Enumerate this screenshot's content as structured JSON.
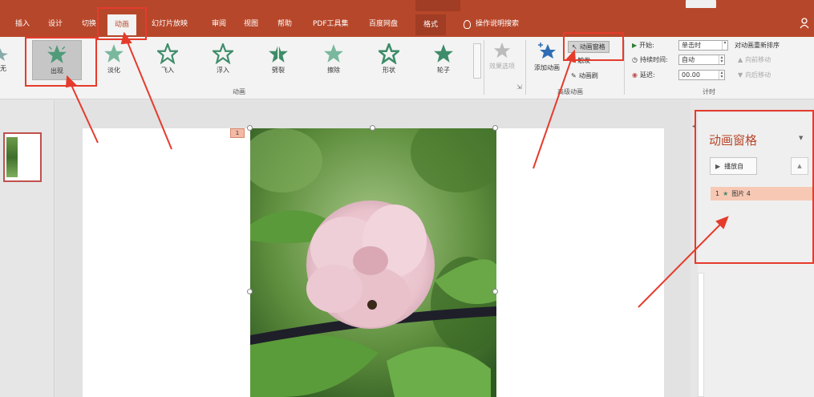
{
  "title_bar": {
    "context_label": "",
    "window_button": ""
  },
  "tabs": [
    {
      "label": "插入"
    },
    {
      "label": "设计"
    },
    {
      "label": "切换"
    },
    {
      "label": "动画"
    },
    {
      "label": "幻灯片放映"
    },
    {
      "label": "审阅"
    },
    {
      "label": "视图"
    },
    {
      "label": "帮助"
    },
    {
      "label": "PDF工具集"
    },
    {
      "label": "百度网盘"
    },
    {
      "label": "格式"
    }
  ],
  "active_tab_index": 3,
  "tell_me": {
    "label": "操作说明搜索"
  },
  "ribbon": {
    "gallery_partial_label": "无",
    "animations": [
      {
        "label": "出现",
        "selected": true
      },
      {
        "label": "淡化"
      },
      {
        "label": "飞入"
      },
      {
        "label": "浮入"
      },
      {
        "label": "劈裂"
      },
      {
        "label": "擦除"
      },
      {
        "label": "形状"
      },
      {
        "label": "轮子"
      }
    ],
    "effect_options": "效果选项",
    "add_animation": "添加动画",
    "animation_pane_button": "动画窗格",
    "trigger": "触发",
    "animation_painter": "动画刷",
    "group_animation": "动画",
    "group_advanced": "高级动画",
    "group_timing": "计时",
    "timing": {
      "start_label": "开始:",
      "start_value": "单击时",
      "duration_label": "持续时间:",
      "duration_value": "自动",
      "delay_label": "延迟:",
      "delay_value": "00.00"
    },
    "reorder": {
      "title": "对动画重新排序",
      "move_earlier": "向前移动",
      "move_later": "向后移动"
    }
  },
  "slide": {
    "anim_badge": "1"
  },
  "animation_pane": {
    "title": "动画窗格",
    "play_button": "播放自",
    "items": [
      {
        "order": "1",
        "name": "图片 4"
      }
    ]
  },
  "colors": {
    "accent": "#b7472a",
    "annotation_red": "#e53b2c",
    "selected_item": "#f7c9b5"
  }
}
